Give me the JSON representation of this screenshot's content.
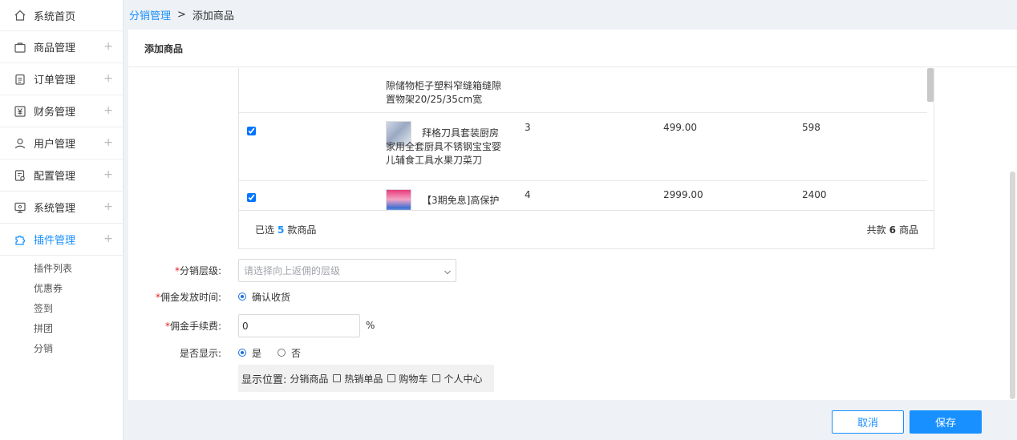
{
  "sidebar": {
    "items": [
      {
        "label": "系统首页",
        "icon": "home-icon",
        "expandable": false
      },
      {
        "label": "商品管理",
        "icon": "bag-icon",
        "expandable": true
      },
      {
        "label": "订单管理",
        "icon": "clipboard-icon",
        "expandable": true
      },
      {
        "label": "财务管理",
        "icon": "yen-icon",
        "expandable": true
      },
      {
        "label": "用户管理",
        "icon": "user-icon",
        "expandable": true
      },
      {
        "label": "配置管理",
        "icon": "settings-doc-icon",
        "expandable": true
      },
      {
        "label": "系统管理",
        "icon": "monitor-icon",
        "expandable": true
      },
      {
        "label": "插件管理",
        "icon": "puzzle-icon",
        "expandable": true,
        "active": true
      }
    ],
    "plus": "+",
    "submenu": [
      "插件列表",
      "优惠券",
      "签到",
      "拼团",
      "分销"
    ]
  },
  "breadcrumb": {
    "parent": "分销管理",
    "separator": ">",
    "current": "添加商品"
  },
  "card": {
    "title": "添加商品"
  },
  "products": {
    "rows": [
      {
        "name_partial": "隙储物柜子塑料窄缝箱缝隙置物架20/25/35cm宽"
      },
      {
        "checked": true,
        "name": "拜格刀具套装厨房家用全套厨具不锈钢宝宝婴儿辅食工具水果刀菜刀",
        "col1": "3",
        "col2": "499.00",
        "col3": "598"
      },
      {
        "checked": true,
        "name": "【3期免息]高保护",
        "col1": "4",
        "col2": "2999.00",
        "col3": "2400"
      }
    ],
    "footer": {
      "selected_prefix": "已选",
      "selected_count": "5",
      "selected_suffix": "款商品",
      "total_prefix": "共款",
      "total_count": "6",
      "total_suffix": "商品"
    }
  },
  "form": {
    "level": {
      "label": "分销层级:",
      "placeholder": "请选择向上返佣的层级"
    },
    "commission_time": {
      "label": "佣金发放时间:",
      "option": "确认收货"
    },
    "fee": {
      "label": "佣金手续费:",
      "value": "0",
      "unit": "%"
    },
    "display": {
      "label": "是否显示:",
      "yes": "是",
      "no": "否"
    },
    "position": {
      "label": "显示位置:",
      "options": [
        "分销商品",
        "热销单品",
        "购物车",
        "个人中心"
      ]
    }
  },
  "buttons": {
    "cancel": "取消",
    "save": "保存"
  },
  "colors": {
    "primary": "#1890ff",
    "required": "#e02020"
  }
}
